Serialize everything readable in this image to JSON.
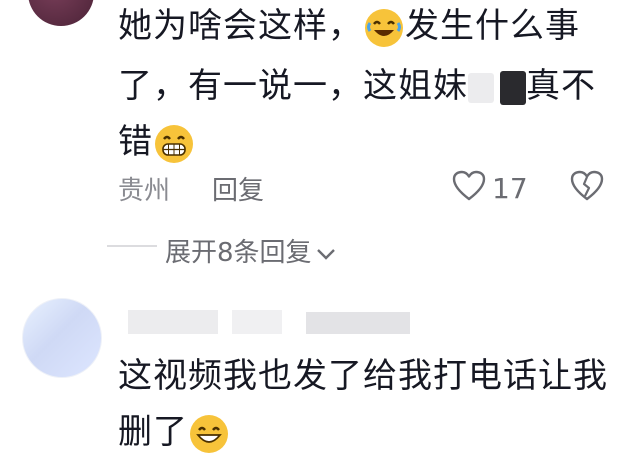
{
  "comment1": {
    "line1_a": "她为啥会这样，",
    "line1_b": "发生什么事",
    "line2_a": "了，有一说一，这姐妹",
    "line2_b": "真不",
    "line3_a": "错",
    "emoji_laugh": "rofl-emoji",
    "emoji_grin": "grin-emoji",
    "location": "贵州",
    "reply_label": "回复",
    "like_count": "17",
    "expand_label": "展开8条回复"
  },
  "comment2": {
    "line1": "这视频我也发了给我打电话让我",
    "line2_a": "删了",
    "emoji_smile": "smile-emoji"
  },
  "colors": {
    "text": "#161823",
    "meta": "#8a8b91",
    "emoji": "#f7c33a"
  }
}
